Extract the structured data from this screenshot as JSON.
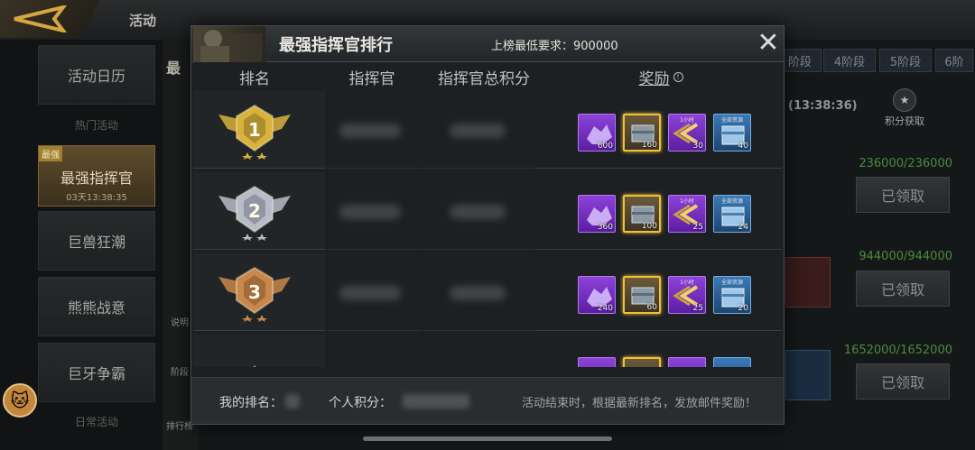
{
  "background": {
    "title": "活动",
    "sidebar": {
      "items": [
        "活动日历",
        "巨兽狂潮",
        "熊熊战意",
        "巨牙争霸"
      ],
      "subheaders": [
        "热门活动",
        "日常活动"
      ],
      "active": {
        "tag": "最强",
        "name": "最强指挥官",
        "time": "03天13:38:35"
      }
    },
    "mid_strip": {
      "title": "最",
      "buttons": [
        "说明",
        "阶段",
        "排行榜"
      ]
    },
    "stages": [
      "阶段",
      "4阶段",
      "5阶段",
      "6阶"
    ],
    "timer": "(13:38:36)",
    "score_get_label": "积分获取",
    "tasks": [
      {
        "progress": "236000/236000",
        "button": "已领取"
      },
      {
        "progress": "944000/944000",
        "button": "已领取"
      },
      {
        "progress": "1652000/1652000",
        "button": "已领取"
      }
    ]
  },
  "modal": {
    "title": "最强指挥官排行",
    "requirement": "上榜最低要求：900000",
    "close_symbol": "✕",
    "columns": {
      "rank": "排名",
      "commander": "指挥官",
      "score": "指挥官总积分",
      "reward": "奖励"
    },
    "rows": [
      {
        "rank": "1",
        "medal_color": "#d8b23c",
        "rewards": [
          {
            "type": "crystal",
            "count": "600"
          },
          {
            "type": "chest",
            "count": "160"
          },
          {
            "type": "speedup",
            "label": "1小时",
            "count": "30"
          },
          {
            "type": "box",
            "label": "全部资源",
            "count": "40"
          }
        ]
      },
      {
        "rank": "2",
        "medal_color": "#b8bcc9",
        "rewards": [
          {
            "type": "crystal",
            "count": "360"
          },
          {
            "type": "chest",
            "count": "100"
          },
          {
            "type": "speedup",
            "label": "1小时",
            "count": "25"
          },
          {
            "type": "box",
            "label": "全部资源",
            "count": "24"
          }
        ]
      },
      {
        "rank": "3",
        "medal_color": "#c9874a",
        "rewards": [
          {
            "type": "crystal",
            "count": "240"
          },
          {
            "type": "chest",
            "count": "60"
          },
          {
            "type": "speedup",
            "label": "1小时",
            "count": "25"
          },
          {
            "type": "box",
            "label": "全部资源",
            "count": "20"
          }
        ]
      }
    ],
    "footer": {
      "my_rank_label": "我的排名：",
      "my_score_label": "个人积分：",
      "note": "活动结束时，根据最新排名，发放邮件奖励！"
    }
  }
}
